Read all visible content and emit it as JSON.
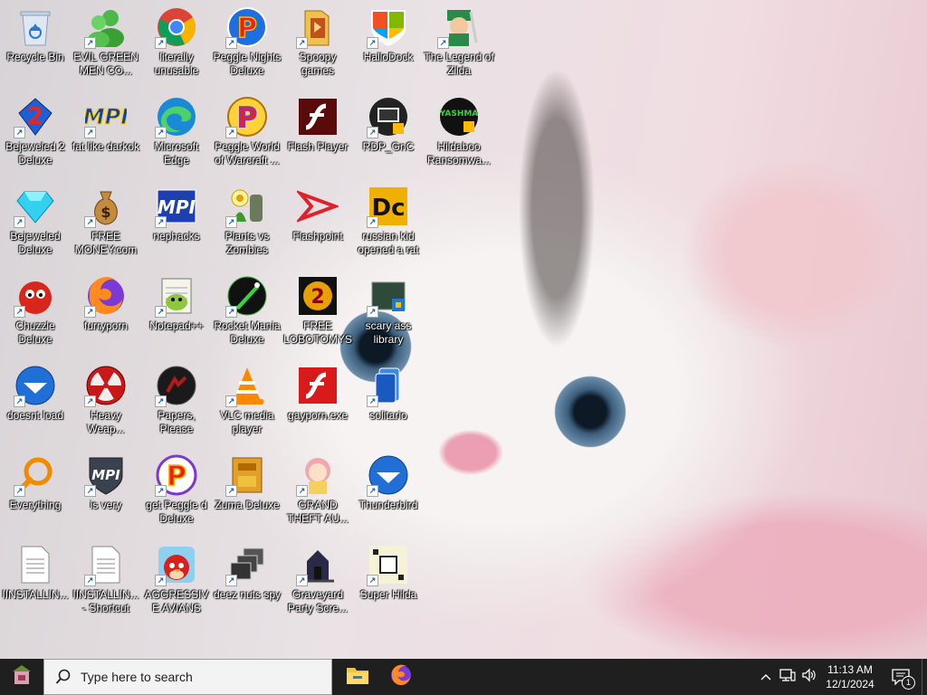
{
  "desktop": {
    "icons": [
      {
        "label": "Recycle Bin",
        "icon": "recycle-bin-icon"
      },
      {
        "label": "EVIL GREEN MEN CO...",
        "icon": "green-men-icon"
      },
      {
        "label": "literally unusable",
        "icon": "chrome-icon"
      },
      {
        "label": "Peggle Nights Deluxe",
        "icon": "peggle-icon"
      },
      {
        "label": "Spoopy games",
        "icon": "folder-icon"
      },
      {
        "label": "HalloDock",
        "icon": "windows-shield-icon"
      },
      {
        "label": "The Legend of Zilda",
        "icon": "zelda-icon"
      },
      {
        "label": "Bejeweled 2 Deluxe",
        "icon": "bejeweled2-icon"
      },
      {
        "label": "fat like darkok",
        "icon": "mpi-icon"
      },
      {
        "label": "Microsoft Edge",
        "icon": "edge-icon"
      },
      {
        "label": "Peggle World of Warcraft ...",
        "icon": "peggle-icon"
      },
      {
        "label": "Flash Player",
        "icon": "flash-icon"
      },
      {
        "label": "RDP_GnC",
        "icon": "rdp-icon"
      },
      {
        "label": "Hildaboo Ransomwa...",
        "icon": "yashma-icon"
      },
      {
        "label": "Bejeweled Deluxe",
        "icon": "gem-icon"
      },
      {
        "label": "FREE MONEY.com",
        "icon": "money-bag-icon"
      },
      {
        "label": "nephacks",
        "icon": "mpi-icon"
      },
      {
        "label": "Plants vs Zombies",
        "icon": "pvz-icon"
      },
      {
        "label": "Flashpoint",
        "icon": "flashpoint-icon"
      },
      {
        "label": "russian kid opened a rat",
        "icon": "dc-icon"
      },
      {
        "label": "Chuzzle Deluxe",
        "icon": "chuzzle-icon"
      },
      {
        "label": "furryporn",
        "icon": "firefox-icon"
      },
      {
        "label": "Notepad++",
        "icon": "notepadpp-icon"
      },
      {
        "label": "Rocket Mania Deluxe",
        "icon": "rocket-icon"
      },
      {
        "label": "FREE LOBOTOMYS",
        "icon": "lobotomy-icon"
      },
      {
        "label": "scary ass library",
        "icon": "library-icon"
      },
      {
        "label": "doesnt load",
        "icon": "thunderbird-icon"
      },
      {
        "label": "Heavy Weap...",
        "icon": "radiation-icon"
      },
      {
        "label": "Papers, Please",
        "icon": "papers-please-icon"
      },
      {
        "label": "VLC media player",
        "icon": "vlc-icon"
      },
      {
        "label": "gayporn.exe",
        "icon": "flash-icon"
      },
      {
        "label": "solitario",
        "icon": "solitaire-icon"
      },
      {
        "label": "Everything",
        "icon": "search-magnifier-icon"
      },
      {
        "label": "is very",
        "icon": "mpi-shield-icon"
      },
      {
        "label": "get Peggle d Deluxe",
        "icon": "peggle-icon"
      },
      {
        "label": "Zuma Deluxe",
        "icon": "zuma-icon"
      },
      {
        "label": "GRAND THEFT AU...",
        "icon": "anime-girl-icon"
      },
      {
        "label": "Thunderbird",
        "icon": "thunderbird-icon"
      },
      {
        "label": "IINSTALLIN...",
        "icon": "text-file-icon"
      },
      {
        "label": "IINSTALLIN... - Shortcut",
        "icon": "text-file-icon"
      },
      {
        "label": "AGGRESSIVE AVIANS",
        "icon": "angry-bird-icon"
      },
      {
        "label": "deez nuts spy",
        "icon": "stacked-windows-icon"
      },
      {
        "label": "Graveyard Party Scre...",
        "icon": "graveyard-icon"
      },
      {
        "label": "Super Hilda",
        "icon": "super-hilda-icon"
      }
    ]
  },
  "taskbar": {
    "search_placeholder": "Type here to search",
    "pinned": [
      {
        "name": "File Explorer",
        "icon": "file-explorer-icon"
      },
      {
        "name": "Firefox",
        "icon": "firefox-icon"
      }
    ],
    "tray": {
      "time": "11:13 AM",
      "date": "12/1/2024",
      "notification_count": "1"
    }
  },
  "colors": {
    "taskbar_bg": "#1f1f1f",
    "search_bg": "#f3f3f3"
  }
}
